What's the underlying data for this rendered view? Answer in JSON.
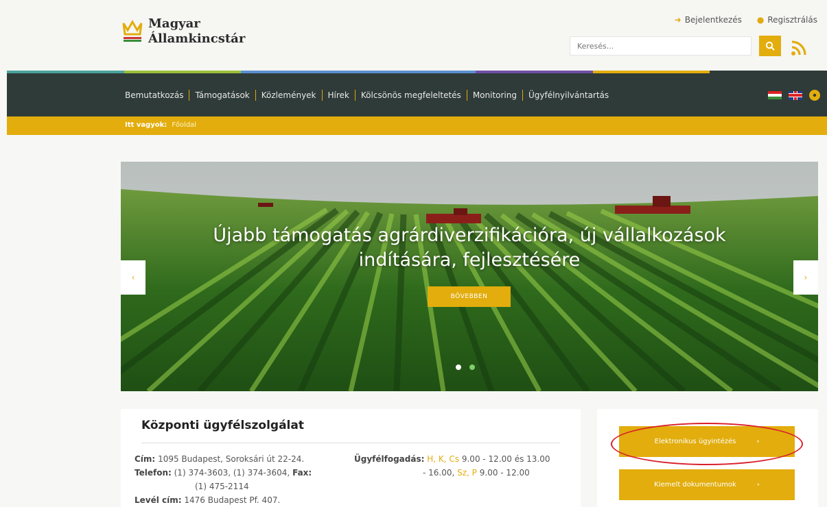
{
  "brand": {
    "line1": "Magyar",
    "line2": "Államkincstár"
  },
  "top_links": {
    "login": "Bejelentkezés",
    "register": "Regisztrálás"
  },
  "search": {
    "placeholder": "Keresés..."
  },
  "nav": {
    "items": [
      "Bemutatkozás",
      "Támogatások",
      "Közlemények",
      "Hírek",
      "Kölcsönös megfeleltetés",
      "Monitoring",
      "Ügyfélnyilvántartás"
    ]
  },
  "breadcrumb": {
    "label": "Itt vagyok:",
    "current": "Főoldal"
  },
  "slider": {
    "title": "Újabb támogatás agrárdiverzifikációra, új vállalkozások indítására, fejlesztésére",
    "button": "BŐVEBBEN",
    "prev": "‹",
    "next": "›"
  },
  "service": {
    "title": "Központi ügyfélszolgálat",
    "address_label": "Cím:",
    "address": "1095 Budapest, Soroksári út 22-24.",
    "phone_label": "Telefon:",
    "phone": "(1) 374-3603, (1) 374-3604,",
    "fax_label": "Fax:",
    "fax": "(1) 475-2114",
    "mail_label": "Levél cím:",
    "mail": "1476 Budapest Pf. 407.",
    "hours_label": "Ügyfélfogadás:",
    "hours_days1": "H, K, Cs",
    "hours_time1": "9.00 - 12.00 és 13.00",
    "hours_time1b": "- 16.00,",
    "hours_days2": "Sz, P",
    "hours_time2": "9.00 - 12.00"
  },
  "side_buttons": {
    "electronic": "Elektronikus ügyintézés",
    "documents": "Kiemelt dokumentumok",
    "chevron": "›"
  },
  "colors": {
    "accent": "#e2ad0d",
    "nav_bg": "#2f3b38",
    "highlight_circle": "#d8202a"
  }
}
